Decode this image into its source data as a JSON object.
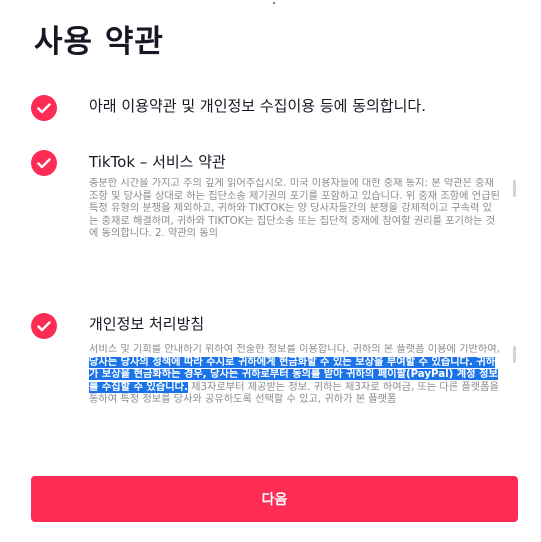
{
  "page": {
    "title": "사용 약관"
  },
  "agreements": [
    {
      "label": "아래 이용약관 및 개인정보 수집이용 등에 동의합니다.",
      "checked": true
    },
    {
      "label": "TikTok – 서비스 약관",
      "checked": true,
      "body": "충분한 시간을 가지고 주의 깊게 읽어주십시오. 미국 이용자들에 대한 중재 통지: 본 약관은 중재 조항 및 당사를 상대로 하는 집단소송 제기권의 포기를 포함하고 있습니다. 위 중재 조항에 언급된 특정 유형의 분쟁을 제외하고, 귀하와 TIKTOK는 양 당사자들간의 분쟁을 강제적이고 구속력 있는 중재로 해결하며, 귀하와 TIKTOK는 집단소송 또는 집단적 중재에 참여할 권리를 포기하는 것에 동의합니다. 2. 약관의 동의"
    },
    {
      "label": "개인정보 처리방침",
      "checked": true,
      "body_before": "서비스 및 기회를 안내하기 위하여 전술한 정보를 이용합니다. 귀하의 본 플랫폼 이용에 기반하여, ",
      "body_highlight": "당사는 당사의 정책에 따라 수시로 귀하에게 현금화할 수 있는 보상을 부여할 수 있습니다. 귀하가 보상을 현금화하는 경우, 당사는 귀하로부터 동의를 받아 귀하의 페이팔(PayPal) 계정 정보를 수집할 수 있습니다.",
      "body_after": " 제3자로부터 제공받는 정보. 귀하는 제3자로 하여금, 또는 다른 플랫폼을 통하여 특정 정보를 당사와 공유하도록 선택할 수 있고, 귀하가 본 플랫폼"
    }
  ],
  "buttons": {
    "next_label": "다음"
  },
  "colors": {
    "accent": "#fe2c55",
    "selection": "#1a73e8",
    "muted_text": "#8a8b91"
  },
  "icons": {
    "check": "check-circle-icon"
  }
}
